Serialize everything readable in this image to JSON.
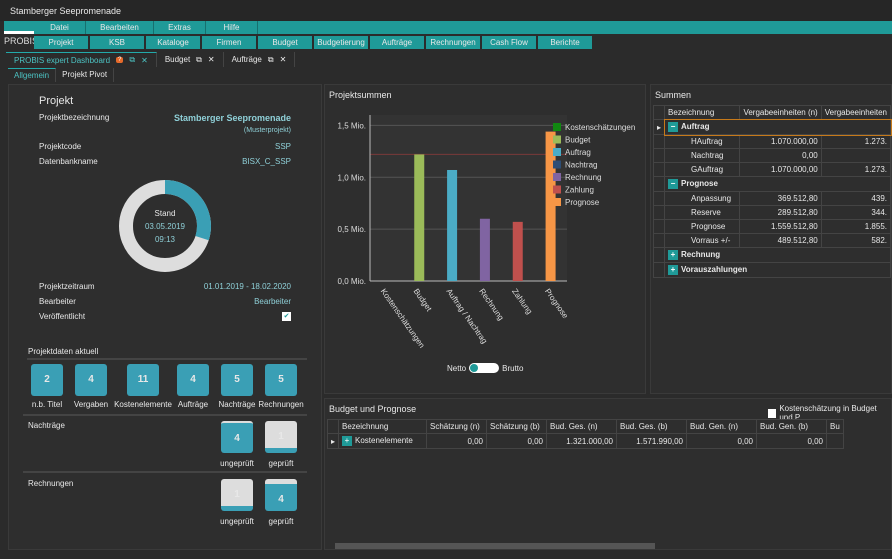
{
  "window": {
    "title": "Stamberger Seepromenade"
  },
  "menu": [
    "Datei",
    "Bearbeiten",
    "Extras",
    "Hilfe"
  ],
  "brand": "PROBIS",
  "nav": [
    "Projekt",
    "KSB",
    "Kataloge",
    "Firmen",
    "Budget",
    "Budgetierung",
    "Aufträge",
    "Rechnungen",
    "Cash Flow",
    "Berichte"
  ],
  "tabs": [
    {
      "label": "PROBIS expert Dashboard",
      "badge": "?"
    },
    {
      "label": "Budget"
    },
    {
      "label": "Aufträge"
    }
  ],
  "subtabs": [
    "Allgemein",
    "Projekt Pivot"
  ],
  "projekt": {
    "heading": "Projekt",
    "fields": [
      {
        "label": "Projektbezeichnung",
        "value": "Stamberger Seepromenade"
      },
      {
        "label": "",
        "value": "(Musterprojekt)"
      },
      {
        "label": "Projektcode",
        "value": "SSP"
      },
      {
        "label": "Datenbankname",
        "value": "BISX_C_SSP"
      }
    ],
    "stand": {
      "label": "Stand",
      "date": "03.05.2019",
      "time": "09:13",
      "progress": 0.3
    },
    "fields2": [
      {
        "label": "Projektzeitraum",
        "value": "01.01.2019 - 18.02.2020"
      },
      {
        "label": "Bearbeiter",
        "value": "Bearbeiter"
      },
      {
        "label": "Veröffentlicht",
        "value": "✔"
      }
    ]
  },
  "aktuell": {
    "heading": "Projektdaten aktuell",
    "tiles": [
      {
        "n": "2",
        "label": "n.b. Titel"
      },
      {
        "n": "4",
        "label": "Vergaben"
      },
      {
        "n": "11",
        "label": "Kostenelemente"
      },
      {
        "n": "4",
        "label": "Aufträge"
      },
      {
        "n": "5",
        "label": "Nachträge"
      },
      {
        "n": "5",
        "label": "Rechnungen"
      }
    ]
  },
  "nachtraege": {
    "heading": "Nachträge",
    "ungeprueft": "4",
    "geprueft": "1",
    "l1": "ungeprüft",
    "l2": "geprüft"
  },
  "rechnungen": {
    "heading": "Rechnungen",
    "ungeprueft": "1",
    "geprueft": "4",
    "l1": "ungeprüft",
    "l2": "geprüft"
  },
  "chart_data": {
    "type": "bar",
    "title": "Projektsummen",
    "categories": [
      "Kostenschätzungen",
      "Budget",
      "Auftrag / Nachtrag",
      "Rechnung",
      "Zahlung",
      "Prognose"
    ],
    "values": [
      0,
      1.22,
      1.07,
      0.6,
      0.57,
      1.44
    ],
    "colors": [
      "#118811",
      "#9bbb59",
      "#4bacc6",
      "#2c4d75",
      "#8064a2",
      "#c0504d",
      "#f79646"
    ],
    "bar_colors": [
      "#118811",
      "#9bbb59",
      "#4bacc6",
      "#8064a2",
      "#c0504d",
      "#f79646"
    ],
    "ylim": [
      0,
      1.6
    ],
    "yticks": [
      "0,0 Mio.",
      "0,5 Mio.",
      "1,0 Mio.",
      "1,5 Mio."
    ],
    "reference_line": 1.22,
    "legend": [
      "Kostenschätzungen",
      "Budget",
      "Auftrag",
      "Nachtrag",
      "Rechnung",
      "Zahlung",
      "Prognose"
    ],
    "legend_position": "right"
  },
  "toggle": {
    "left": "Netto",
    "right": "Brutto"
  },
  "summen": {
    "title": "Summen",
    "cols": [
      "Bezeichnung",
      "Vergabeeinheiten (n)",
      "Vergabeeinheiten"
    ],
    "rows": [
      {
        "g": "Auftrag",
        "t": "−"
      },
      {
        "l": "HAuftrag",
        "a": "1.070.000,00",
        "b": "1.273."
      },
      {
        "l": "Nachtrag",
        "a": "0,00",
        "b": ""
      },
      {
        "l": "GAuftrag",
        "a": "1.070.000,00",
        "b": "1.273."
      },
      {
        "g": "Prognose",
        "t": "−"
      },
      {
        "l": "Anpassung",
        "a": "369.512,80",
        "b": "439."
      },
      {
        "l": "Reserve",
        "a": "289.512,80",
        "b": "344."
      },
      {
        "l": "Prognose",
        "a": "1.559.512,80",
        "b": "1.855."
      },
      {
        "l": "Vorraus +/-",
        "a": "489.512,80",
        "b": "582."
      },
      {
        "g": "Rechnung",
        "t": "+"
      },
      {
        "g": "Vorauszahlungen",
        "t": "+"
      }
    ]
  },
  "budget": {
    "title": "Budget und Prognose",
    "checkbox": "Kostenschätzung in Budget und P",
    "cols": [
      "Bezeichnung",
      "Schätzung (n)",
      "Schätzung (b)",
      "Bud. Ges. (n)",
      "Bud. Ges. (b)",
      "Bud. Gen. (n)",
      "Bud. Gen. (b)",
      "Bu"
    ],
    "row": [
      "Kostenelemente",
      "0,00",
      "0,00",
      "1.321.000,00",
      "1.571.990,00",
      "0,00",
      "0,00",
      ""
    ]
  }
}
